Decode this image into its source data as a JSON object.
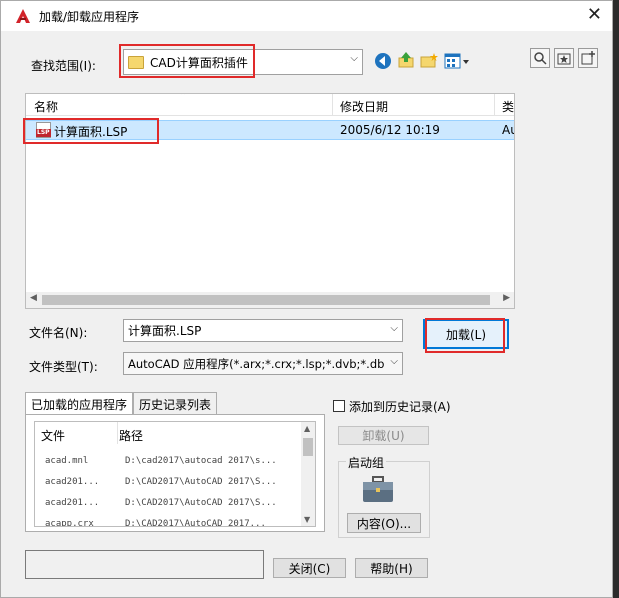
{
  "window": {
    "title": "加载/卸载应用程序",
    "close_glyph": "✕"
  },
  "lookin": {
    "label": "查找范围(I):",
    "value": "CAD计算面积插件"
  },
  "filelist": {
    "columns": [
      "名称",
      "修改日期",
      "类"
    ],
    "rows": [
      {
        "icon_text": "LSP",
        "name": "计算面积.LSP",
        "date": "2005/6/12 10:19",
        "type": "Au"
      }
    ]
  },
  "filename": {
    "label": "文件名(N):",
    "value": "计算面积.LSP"
  },
  "filetype": {
    "label": "文件类型(T):",
    "value": "AutoCAD 应用程序(*.arx;*.crx;*.lsp;*.dvb;*.dbx"
  },
  "load_button": "加载(L)",
  "tabs": [
    "已加载的应用程序",
    "历史记录列表"
  ],
  "loaded_list": {
    "headers": [
      "文件",
      "路径"
    ],
    "rows": [
      {
        "file": "acad.mnl",
        "path": "D:\\cad2017\\autocad 2017\\s..."
      },
      {
        "file": "acad201...",
        "path": "D:\\CAD2017\\AutoCAD 2017\\S..."
      },
      {
        "file": "acad201...",
        "path": "D:\\CAD2017\\AutoCAD 2017\\S..."
      },
      {
        "file": "acapp.crx",
        "path": "D:\\CAD2017\\AutoCAD 2017..."
      }
    ]
  },
  "add_history": "添加到历史记录(A)",
  "unload_button": "卸载(U)",
  "startup": {
    "title": "启动组",
    "contents_button": "内容(O)..."
  },
  "close_button": "关闭(C)",
  "help_button": "帮助(H)",
  "colors": {
    "highlight": "#e02a2a",
    "selection": "#cce8ff",
    "accent": "#0078d7"
  }
}
